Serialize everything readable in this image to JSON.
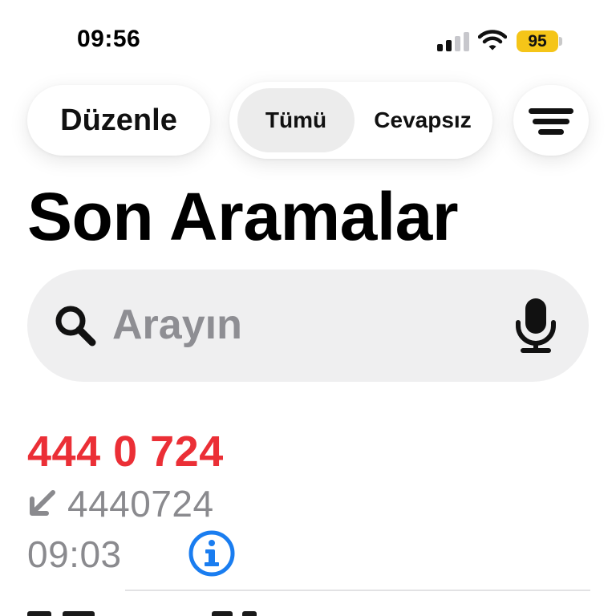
{
  "status_bar": {
    "time": "09:56",
    "battery_level": "95",
    "battery_color": "#f5c518"
  },
  "toolbar": {
    "edit_label": "Düzenle",
    "tabs": [
      {
        "label": "Tümü",
        "selected": true
      },
      {
        "label": "Cevapsız",
        "selected": false
      }
    ],
    "filter_icon": "filter-lines-icon"
  },
  "title": "Son Aramalar",
  "search": {
    "placeholder": "Arayın",
    "value": "",
    "left_icon": "search-icon",
    "right_icon": "microphone-icon"
  },
  "recent_calls": [
    {
      "name": "444 0 724",
      "number": "4440724",
      "time": "09:03",
      "direction_icon": "incoming-call-arrow-icon",
      "missed": true,
      "name_color": "#eb2f36"
    }
  ],
  "colors": {
    "missed_call": "#eb2f36",
    "secondary_text": "#8a8a8e",
    "info_accent": "#1a7df0",
    "search_bg": "#efeff0"
  }
}
